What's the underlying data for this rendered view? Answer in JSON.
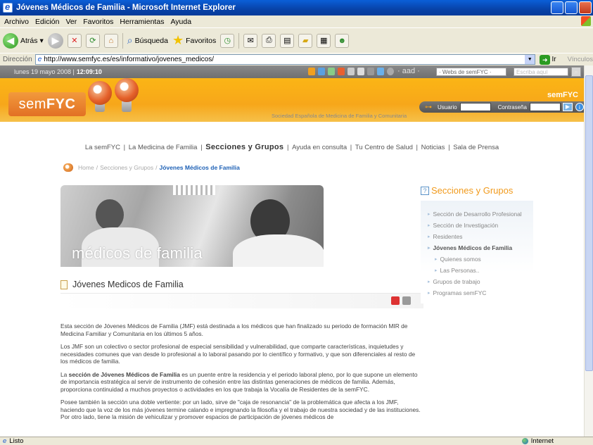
{
  "window": {
    "title": "Jóvenes Médicos de Familia - Microsoft Internet Explorer"
  },
  "menu": [
    "Archivo",
    "Edición",
    "Ver",
    "Favoritos",
    "Herramientas",
    "Ayuda"
  ],
  "toolbar": {
    "back": "Atrás",
    "search": "Búsqueda",
    "favorites": "Favoritos"
  },
  "address": {
    "label": "Dirección",
    "url": "http://www.semfyc.es/es/informativo/jovenes_medicos/",
    "go": "Ir",
    "links": "Vínculos"
  },
  "site": {
    "date": "lunes 19 mayo 2008 |",
    "time": "12:09:10",
    "aad": "aad",
    "sites_select": "· Webs de semFYC ·",
    "search_placeholder": "Escriba aquí",
    "logo_prefix": "sem",
    "logo_suffix": "FYC",
    "logo_corner": "semFYC",
    "tagline": "Sociedad Española de Medicina de Familia y Comunitaria",
    "login": {
      "user_label": "Usuario",
      "password_label": "Contraseña"
    }
  },
  "nav": {
    "items": [
      "La semFYC",
      "La Medicina de Familia",
      "Secciones y Grupos",
      "Ayuda en consulta",
      "Tu Centro de Salud",
      "Noticias",
      "Sala de Prensa"
    ]
  },
  "breadcrumb": {
    "home": "Home",
    "parent": "Secciones y Grupos",
    "current": "Jóvenes Médicos de Familia"
  },
  "hero": {
    "caption": "médicos de familia"
  },
  "article": {
    "title": "Jóvenes Medicos de Familia",
    "p1": "Esta sección de Jóvenes Médicos de Familia (JMF) está destinada a los médicos que han finalizado su periodo de formación MIR de Medicina Familiar y Comunitaria en los últimos 5 años.",
    "p2": "Los JMF son un colectivo o sector profesional de especial sensibilidad y vulnerabilidad, que comparte características, inquietudes y necesidades comunes que van desde lo profesional a lo laboral pasando por lo científico y formativo, y que son diferenciales al resto de los médicos de familia.",
    "p3_prefix": "La",
    "p3_strong": "sección de Jóvenes Médicos de Familia",
    "p3_rest": "es un puente entre la residencia y el periodo laboral pleno, por lo que supone un elemento de importancia estratégica al servir de instrumento de cohesión entre las distintas generaciones de médicos de familia. Además, proporciona continuidad a muchos proyectos o actividades en los que trabaja la Vocalía de Residentes de la semFYC.",
    "p4": "Posee también la sección una doble vertiente: por un lado, sirve de \"caja de resonancia\" de la problemática que afecta a los JMF, haciendo que la voz de los más jóvenes termine calando e impregnando la filosofía y el trabajo de nuestra sociedad y de las instituciones. Por otro lado, tiene la misión de vehiculizar y promover espacios de participación de jóvenes médicos de"
  },
  "sidebar": {
    "title": "Secciones y Grupos",
    "items": [
      "Sección de Desarrollo Profesional",
      "Sección de Investigación",
      "Residentes",
      "Jóvenes Médicos de Familia",
      "Quienes somos",
      "Las Personas..",
      "Grupos de trabajo",
      "Programas semFYC"
    ]
  },
  "status": {
    "left": "Listo",
    "zone": "Internet"
  },
  "colors": {
    "orange": "#F7A71A",
    "titlebar_blue": "#0842A8",
    "link_blue": "#1D60B5"
  }
}
